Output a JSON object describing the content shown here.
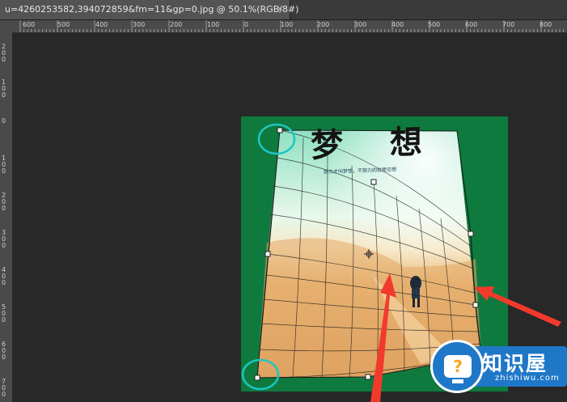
{
  "document_tab": {
    "title": "u=4260253582,394072859&fm=11&gp=0.jpg @ 50.1%(RGB/8#)",
    "close_label": "×"
  },
  "ruler_top": {
    "labels": [
      "600",
      "500",
      "400",
      "300",
      "200",
      "100",
      "0",
      "100",
      "200",
      "300",
      "400",
      "500",
      "600",
      "700",
      "800"
    ]
  },
  "ruler_left": {
    "labels": [
      "200",
      "100",
      "0",
      "100",
      "200",
      "300",
      "400",
      "500",
      "600",
      "700"
    ]
  },
  "image": {
    "title": "梦 想",
    "subtitle": "努力才叫梦想，不努力的就是空想"
  },
  "watermark": {
    "cn": "知识屋",
    "en": "zhishiwu.com",
    "icon_symbol": "?"
  },
  "colors": {
    "canvas_bg": "#282828",
    "document_bg": "#0e7a3e",
    "circle_highlight": "#1cc7c1",
    "arrow": "#f23a2c",
    "brand_blue": "#1f77c8"
  }
}
